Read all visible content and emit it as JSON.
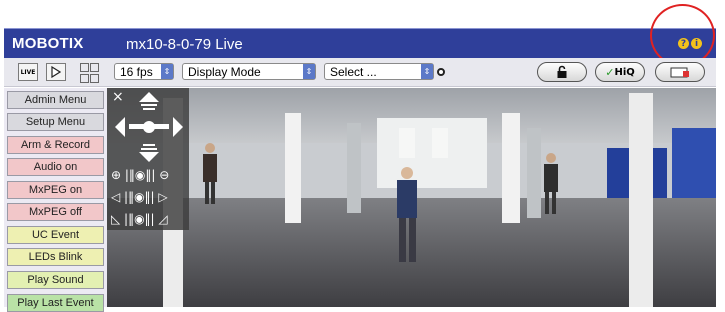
{
  "app": {
    "brand": "MOBOTIX",
    "camera_title": "mx10-8-0-79 Live"
  },
  "toolbar": {
    "live_label": "LIVE",
    "play_icon": "play-icon",
    "grid_icon": "grid-view-icon",
    "fps": "16 fps",
    "display_mode": "Display Mode",
    "select": "Select ...",
    "hiq_label": "HiQ"
  },
  "sidebar": {
    "items": [
      {
        "label": "Admin Menu",
        "color": "#d9d9de"
      },
      {
        "label": "Setup Menu",
        "color": "#d9d9de"
      },
      {
        "label": "Arm & Record",
        "color": "#f2c7c9"
      },
      {
        "label": "Audio on",
        "color": "#f2c7c9"
      },
      {
        "label": "MxPEG on",
        "color": "#f2c7c9"
      },
      {
        "label": "MxPEG off",
        "color": "#f2c7c9"
      },
      {
        "label": "UC Event",
        "color": "#eef0b2"
      },
      {
        "label": "LEDs Blink",
        "color": "#eef0b2"
      },
      {
        "label": "Play Sound",
        "color": "#e3f0b2"
      },
      {
        "label": "Play Last Event",
        "color": "#b9e2a6"
      }
    ]
  },
  "colors": {
    "titlebar": "#2f3f9a",
    "accent": "#f3c21b",
    "highlight_circle": "#e02222"
  }
}
